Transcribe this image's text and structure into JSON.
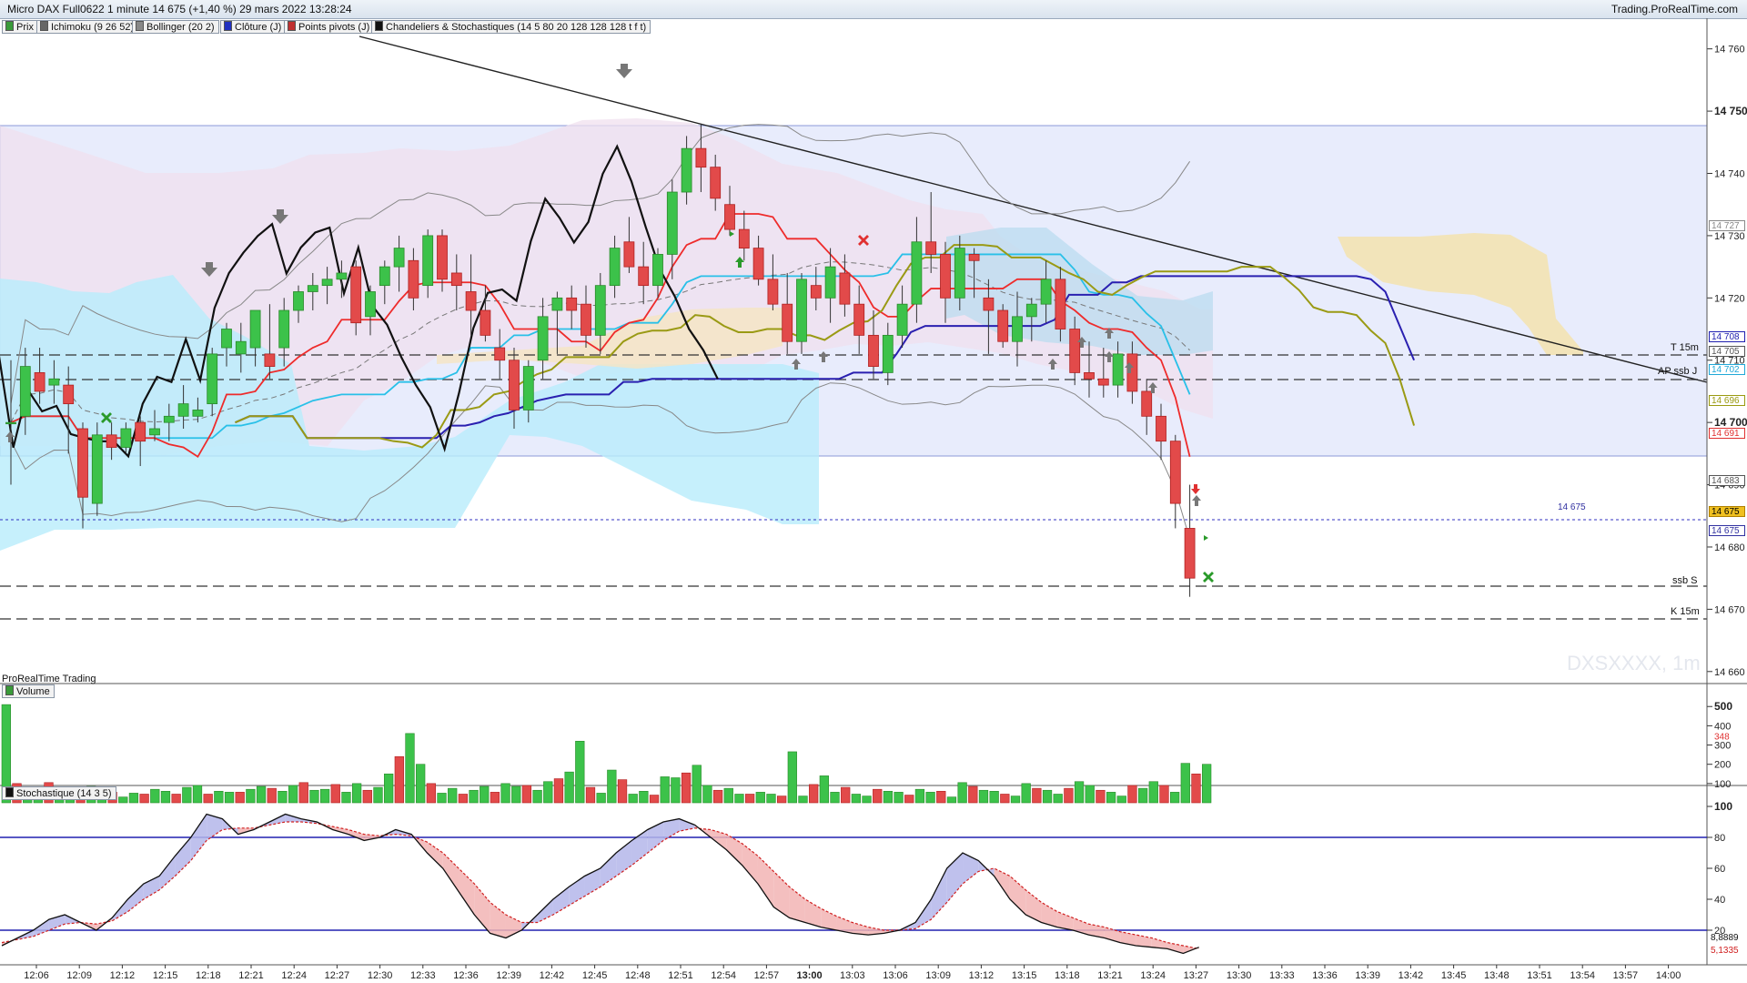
{
  "header": {
    "title": "Micro DAX Full0622 1 minute 14 675 (+1,40 %) 29 mars 2022 13:28:24",
    "brand": "Trading.ProRealTime.com"
  },
  "indicators": [
    {
      "label": "Prix",
      "color": "#3a9b3a"
    },
    {
      "label": "Ichimoku (9 26 52)",
      "color": "#666666"
    },
    {
      "label": "Bollinger (20 2)",
      "color": "#888888"
    },
    {
      "label": "Clôture (J)",
      "color": "#2030c0"
    },
    {
      "label": "Points pivots (J)",
      "color": "#c03030"
    },
    {
      "label": "Chandeliers & Stochastiques (14 5 80 20 128 128 128 t f t)",
      "color": "#111111"
    }
  ],
  "price_axis": {
    "ticks": [
      "14 760",
      "14 750",
      "14 740",
      "14 730",
      "14 720",
      "14 710",
      "14 700",
      "14 690",
      "14 680",
      "14 670",
      "14 660"
    ],
    "bold_ticks": [
      "14 750",
      "14 700"
    ]
  },
  "price_labels": [
    {
      "text": "14 727",
      "color": "#888888"
    },
    {
      "text": "14 708",
      "color": "#2020b0"
    },
    {
      "text": "14 705",
      "color": "#555555"
    },
    {
      "text": "14 702",
      "color": "#20a8d8"
    },
    {
      "text": "14 696",
      "color": "#9a9a10"
    },
    {
      "text": "14 691",
      "color": "#e03030"
    },
    {
      "text": "14 683",
      "color": "#555555"
    },
    {
      "text": "14 675",
      "color": "#000000",
      "bg": "#f0c020"
    },
    {
      "text": "14 675",
      "color": "#3030a0"
    }
  ],
  "level_labels": {
    "t15m": "T 15m",
    "ap_ssbj": "AP ssb J",
    "ssbs": "ssb S",
    "k15m": "K 15m",
    "last_price": "14 675"
  },
  "watermark": "DXSXXXX, 1m",
  "panel_title": "ProRealTime Trading",
  "volume": {
    "label": "Volume",
    "ticks": [
      "500",
      "400",
      "300",
      "200",
      "100"
    ],
    "last": "348"
  },
  "stochastic": {
    "label": "Stochastique (14 3 5)",
    "ticks": [
      "100",
      "80",
      "60",
      "40",
      "20"
    ],
    "values": [
      "8,8889",
      "5,1335"
    ]
  },
  "time_axis": {
    "ticks": [
      "12:06",
      "12:09",
      "12:12",
      "12:15",
      "12:18",
      "12:21",
      "12:24",
      "12:27",
      "12:30",
      "12:33",
      "12:36",
      "12:39",
      "12:42",
      "12:45",
      "12:48",
      "12:51",
      "12:54",
      "12:57",
      "13:00",
      "13:03",
      "13:06",
      "13:09",
      "13:12",
      "13:15",
      "13:18",
      "13:21",
      "13:24",
      "13:27",
      "13:30",
      "13:33",
      "13:36",
      "13:39",
      "13:42",
      "13:45",
      "13:48",
      "13:51",
      "13:54",
      "13:57",
      "14:00"
    ],
    "bold": "13:00"
  },
  "chart_data": {
    "type": "candlestick",
    "instrument": "Micro DAX Full0622",
    "interval": "1 minute",
    "x_start": "12:05",
    "y_range": [
      14655,
      14762
    ],
    "candles": [
      [
        14700,
        14710,
        14690,
        14700
      ],
      [
        14701,
        14712,
        14698,
        14709
      ],
      [
        14708,
        14712,
        14703,
        14705
      ],
      [
        14706,
        14710,
        14703,
        14707
      ],
      [
        14706,
        14709,
        14695,
        14703
      ],
      [
        14699,
        14700,
        14683,
        14688
      ],
      [
        14687,
        14700,
        14685,
        14698
      ],
      [
        14698,
        14700,
        14694,
        14696
      ],
      [
        14696,
        14700,
        14695,
        14699
      ],
      [
        14700,
        14701,
        14693,
        14697
      ],
      [
        14698,
        14702,
        14697,
        14699
      ],
      [
        14700,
        14703,
        14697,
        14701
      ],
      [
        14701,
        14706,
        14699,
        14703
      ],
      [
        14701,
        14704,
        14700,
        14702
      ],
      [
        14703,
        14712,
        14701,
        14711
      ],
      [
        14712,
        14716,
        14709,
        14715
      ],
      [
        14711,
        14716,
        14708,
        14713
      ],
      [
        14712,
        14717,
        14709,
        14718
      ],
      [
        14711,
        14719,
        14707,
        14709
      ],
      [
        14712,
        14720,
        14709,
        14718
      ],
      [
        14718,
        14722,
        14716,
        14721
      ],
      [
        14721,
        14724,
        14718,
        14722
      ],
      [
        14722,
        14725,
        14719,
        14723
      ],
      [
        14723,
        14726,
        14720,
        14724
      ],
      [
        14725,
        14726,
        14714,
        14716
      ],
      [
        14717,
        14722,
        14714,
        14721
      ],
      [
        14722,
        14726,
        14719,
        14725
      ],
      [
        14725,
        14730,
        14721,
        14728
      ],
      [
        14726,
        14728,
        14718,
        14720
      ],
      [
        14722,
        14731,
        14720,
        14730
      ],
      [
        14730,
        14731,
        14721,
        14723
      ],
      [
        14724,
        14727,
        14718,
        14722
      ],
      [
        14721,
        14727,
        14714,
        14718
      ],
      [
        14718,
        14722,
        14713,
        14714
      ],
      [
        14712,
        14715,
        14707,
        14710
      ],
      [
        14710,
        14712,
        14699,
        14702
      ],
      [
        14702,
        14710,
        14700,
        14709
      ],
      [
        14710,
        14720,
        14707,
        14717
      ],
      [
        14718,
        14721,
        14711,
        14720
      ],
      [
        14720,
        14722,
        14715,
        14718
      ],
      [
        14719,
        14722,
        14712,
        14714
      ],
      [
        14714,
        14724,
        14711,
        14722
      ],
      [
        14722,
        14730,
        14720,
        14728
      ],
      [
        14729,
        14733,
        14724,
        14725
      ],
      [
        14725,
        14729,
        14719,
        14722
      ],
      [
        14722,
        14728,
        14720,
        14727
      ],
      [
        14727,
        14739,
        14723,
        14737
      ],
      [
        14737,
        14746,
        14735,
        14744
      ],
      [
        14744,
        14748,
        14737,
        14741
      ],
      [
        14741,
        14743,
        14734,
        14736
      ],
      [
        14735,
        14738,
        14730,
        14731
      ],
      [
        14731,
        14734,
        14726,
        14728
      ],
      [
        14728,
        14730,
        14722,
        14723
      ],
      [
        14723,
        14727,
        14718,
        14719
      ],
      [
        14719,
        14724,
        14711,
        14713
      ],
      [
        14713,
        14724,
        14711,
        14723
      ],
      [
        14722,
        14725,
        14718,
        14720
      ],
      [
        14720,
        14728,
        14716,
        14725
      ],
      [
        14724,
        14727,
        14717,
        14719
      ],
      [
        14719,
        14722,
        14711,
        14714
      ],
      [
        14714,
        14718,
        14707,
        14709
      ],
      [
        14708,
        14716,
        14706,
        14714
      ],
      [
        14714,
        14722,
        14712,
        14719
      ],
      [
        14719,
        14733,
        14716,
        14729
      ],
      [
        14729,
        14737,
        14724,
        14727
      ],
      [
        14727,
        14729,
        14716,
        14720
      ],
      [
        14720,
        14730,
        14718,
        14728
      ],
      [
        14727,
        14728,
        14720,
        14726
      ],
      [
        14720,
        14723,
        14711,
        14718
      ],
      [
        14718,
        14719,
        14712,
        14713
      ],
      [
        14713,
        14721,
        14709,
        14717
      ],
      [
        14717,
        14720,
        14713,
        14719
      ],
      [
        14719,
        14726,
        14716,
        14723
      ],
      [
        14723,
        14725,
        14713,
        14715
      ],
      [
        14715,
        14717,
        14706,
        14708
      ],
      [
        14708,
        14713,
        14704,
        14707
      ],
      [
        14707,
        14712,
        14704,
        14706
      ],
      [
        14706,
        14713,
        14704,
        14711
      ],
      [
        14711,
        14713,
        14703,
        14705
      ],
      [
        14705,
        14707,
        14698,
        14701
      ],
      [
        14701,
        14703,
        14694,
        14697
      ],
      [
        14697,
        14698,
        14683,
        14687
      ],
      [
        14683,
        14690,
        14672,
        14675
      ]
    ],
    "volume": [
      510,
      100,
      60,
      45,
      105,
      75,
      50,
      45,
      85,
      30,
      55,
      30,
      50,
      45,
      70,
      60,
      45,
      80,
      90,
      45,
      60,
      55,
      55,
      70,
      85,
      75,
      60,
      90,
      105,
      65,
      70,
      95,
      55,
      100,
      65,
      80,
      150,
      240,
      360,
      200,
      100,
      50,
      75,
      45,
      65,
      85,
      55,
      100,
      85,
      90,
      65,
      110,
      125,
      160,
      320,
      80,
      50,
      170,
      120,
      45,
      60,
      40,
      135,
      130,
      155,
      195,
      90,
      65,
      75,
      45,
      45,
      55,
      45,
      35,
      265,
      35,
      95,
      140,
      55,
      80,
      45,
      35,
      70,
      60,
      55,
      40,
      70,
      55,
      60,
      30,
      105,
      85,
      65,
      60,
      45,
      35,
      100,
      75,
      65,
      45,
      75,
      110,
      90,
      65,
      55,
      35,
      90,
      75,
      110,
      90,
      55,
      205,
      150,
      200
    ],
    "stochastic_k": [
      10,
      15,
      20,
      27,
      30,
      25,
      20,
      28,
      40,
      50,
      55,
      68,
      80,
      95,
      92,
      82,
      85,
      90,
      95,
      92,
      90,
      85,
      82,
      78,
      80,
      85,
      82,
      70,
      60,
      45,
      30,
      18,
      15,
      20,
      30,
      40,
      48,
      55,
      60,
      70,
      78,
      85,
      90,
      92,
      88,
      80,
      72,
      62,
      50,
      35,
      28,
      25,
      22,
      20,
      18,
      17,
      18,
      20,
      25,
      40,
      60,
      70,
      65,
      55,
      40,
      30,
      25,
      22,
      20,
      17,
      15,
      12,
      10,
      9,
      8,
      5,
      9
    ],
    "stochastic_d": [
      12,
      14,
      16,
      20,
      24,
      25,
      24,
      26,
      32,
      40,
      46,
      55,
      65,
      78,
      85,
      86,
      86,
      88,
      90,
      90,
      89,
      87,
      85,
      82,
      81,
      82,
      81,
      77,
      70,
      60,
      50,
      38,
      30,
      25,
      25,
      30,
      36,
      42,
      48,
      55,
      62,
      70,
      78,
      84,
      86,
      85,
      82,
      76,
      68,
      58,
      48,
      40,
      34,
      29,
      25,
      22,
      20,
      20,
      21,
      27,
      38,
      50,
      58,
      60,
      55,
      46,
      38,
      32,
      28,
      24,
      22,
      19,
      17,
      15,
      12,
      10,
      8
    ]
  }
}
